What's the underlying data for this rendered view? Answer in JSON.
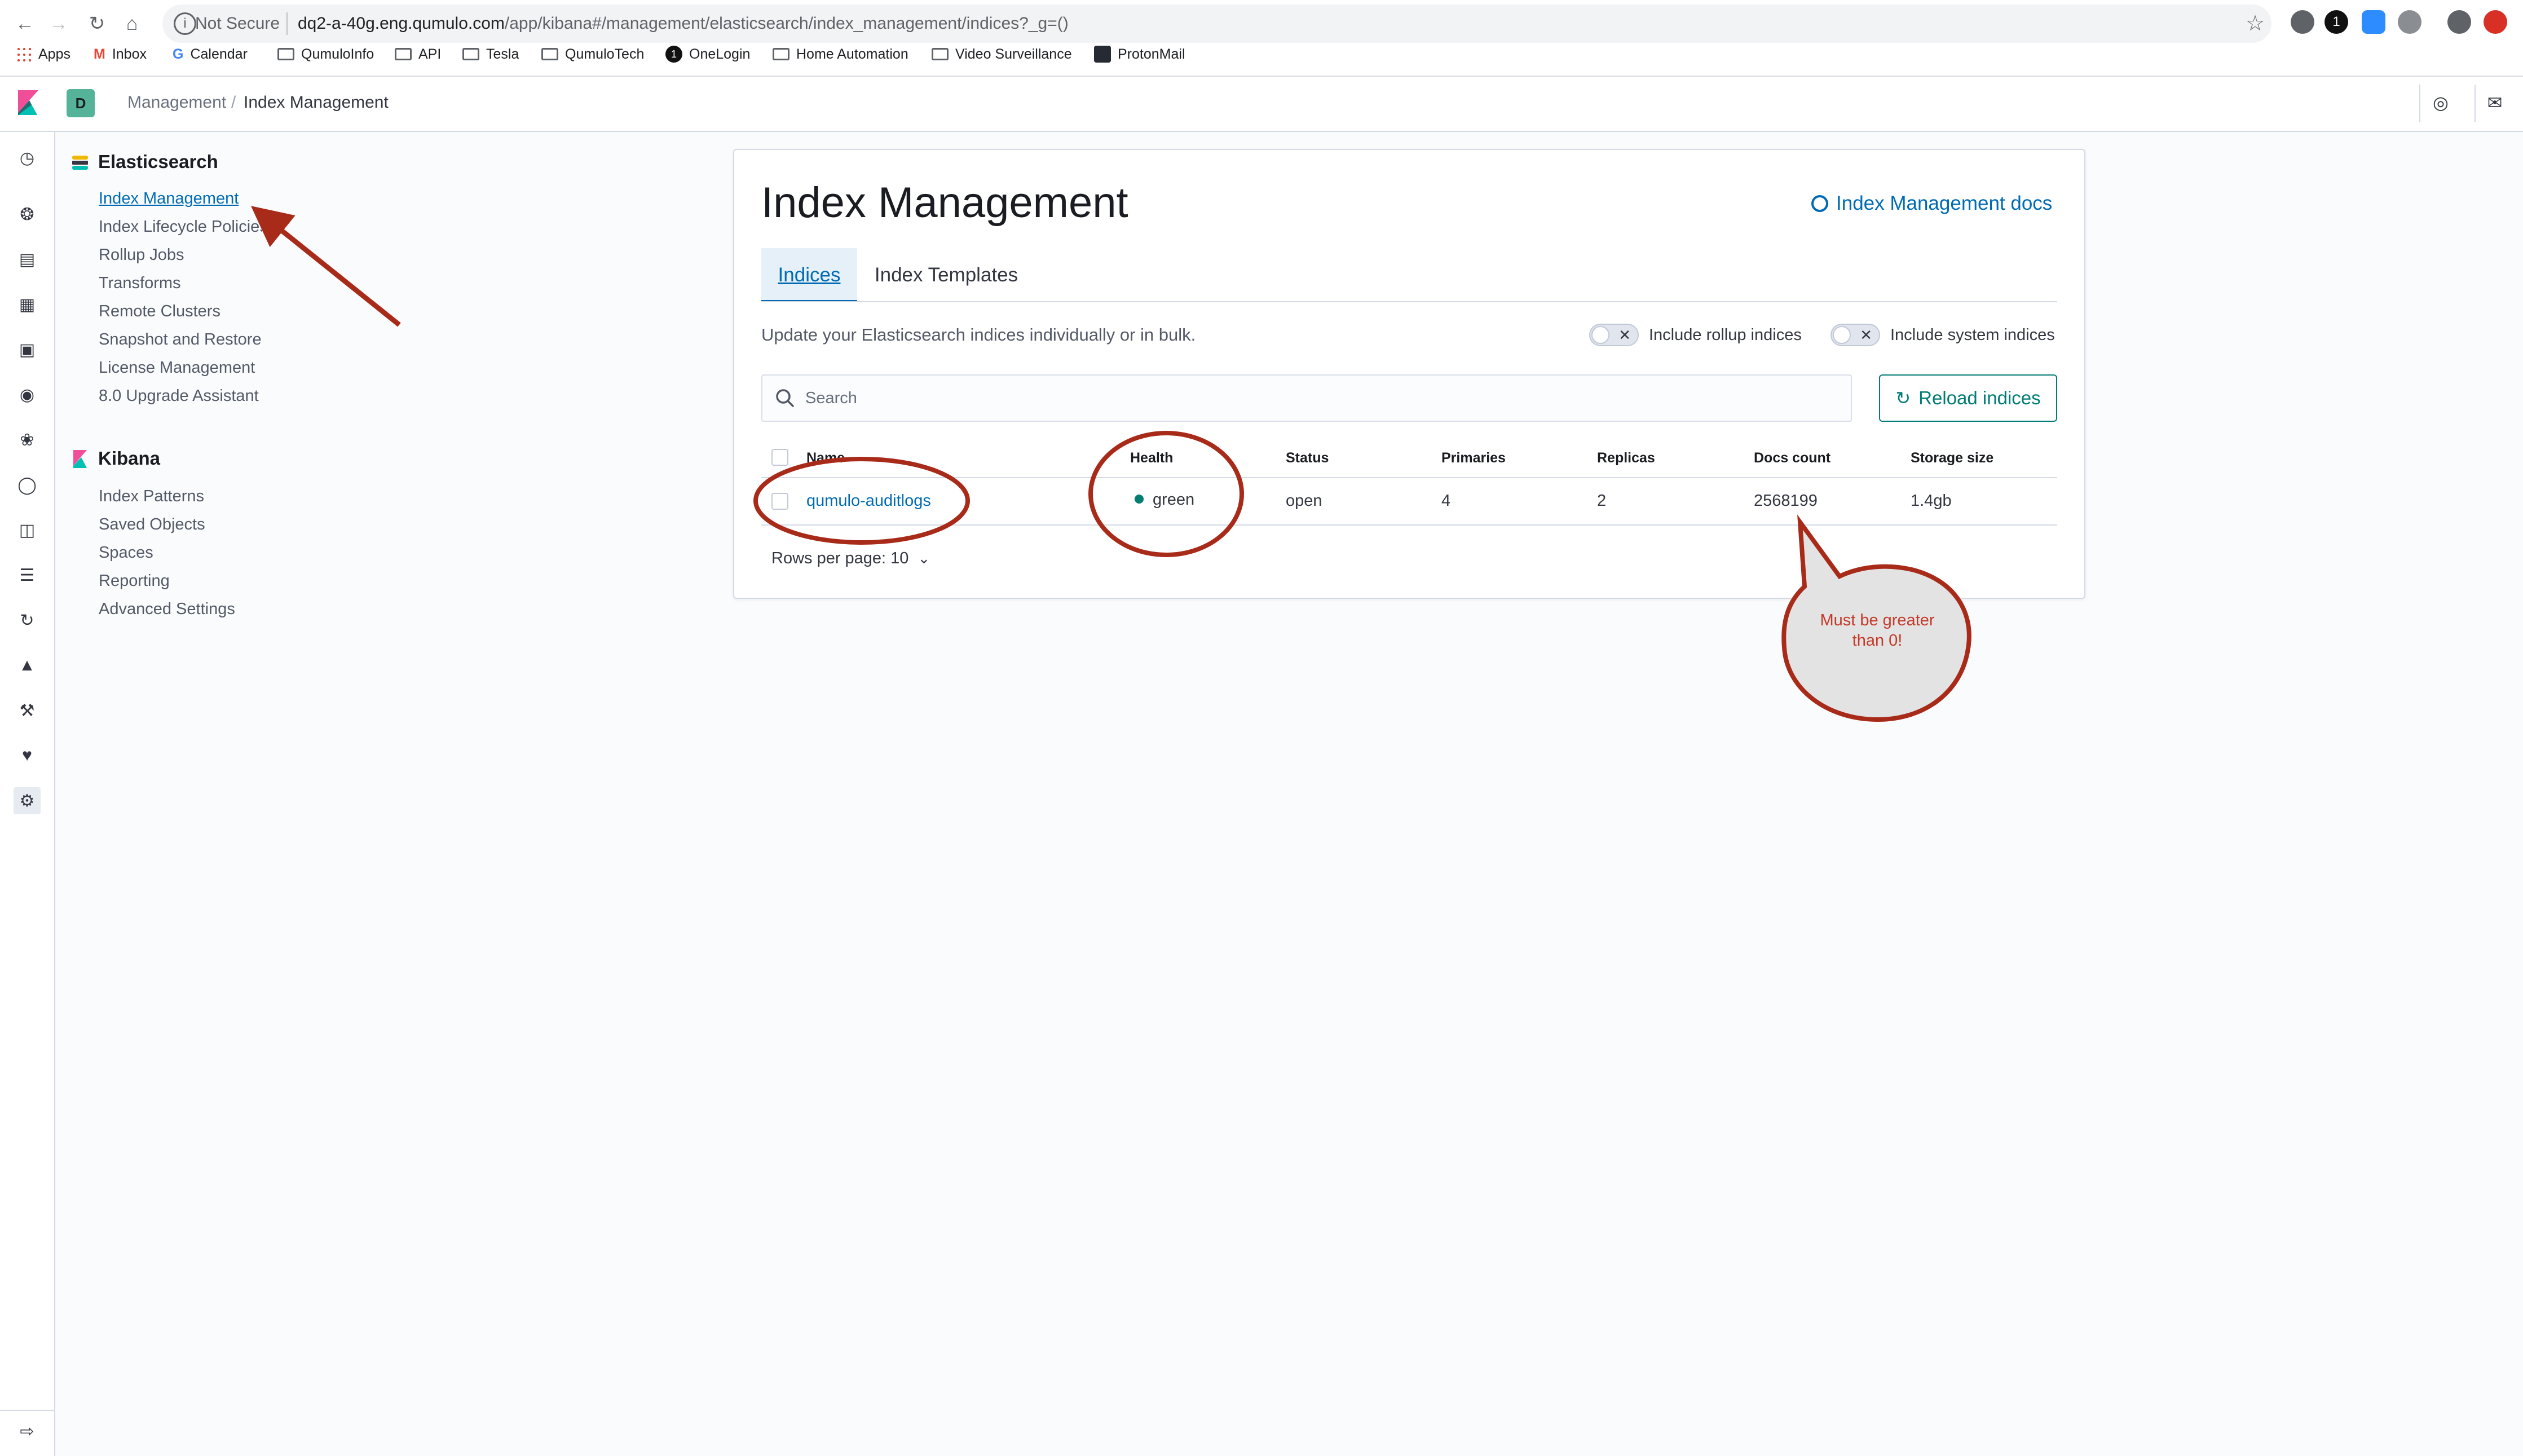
{
  "browser": {
    "url_security": "Not Secure",
    "url_domain": "dq2-a-40g.eng.qumulo.com",
    "url_path": "/app/kibana#/management/elasticsearch/index_management/indices?_g=()",
    "bookmarks": [
      "Apps",
      "Inbox",
      "Calendar",
      "QumuloInfo",
      "API",
      "Tesla",
      "QumuloTech",
      "OneLogin",
      "Home Automation",
      "Video Surveillance",
      "ProtonMail"
    ]
  },
  "header": {
    "space_initial": "D",
    "breadcrumb_parent": "Management",
    "breadcrumb_current": "Index Management"
  },
  "sidebar": {
    "elasticsearch_title": "Elasticsearch",
    "elasticsearch_items": [
      "Index Management",
      "Index Lifecycle Policies",
      "Rollup Jobs",
      "Transforms",
      "Remote Clusters",
      "Snapshot and Restore",
      "License Management",
      "8.0 Upgrade Assistant"
    ],
    "kibana_title": "Kibana",
    "kibana_items": [
      "Index Patterns",
      "Saved Objects",
      "Spaces",
      "Reporting",
      "Advanced Settings"
    ]
  },
  "main": {
    "title": "Index Management",
    "docs_link": "Index Management docs",
    "tabs": [
      "Indices",
      "Index Templates"
    ],
    "description": "Update your Elasticsearch indices individually or in bulk.",
    "toggle_rollup": "Include rollup indices",
    "toggle_system": "Include system indices",
    "search_placeholder": "Search",
    "reload_button": "Reload indices",
    "table": {
      "columns": [
        "Name",
        "Health",
        "Status",
        "Primaries",
        "Replicas",
        "Docs count",
        "Storage size"
      ],
      "rows": [
        {
          "name": "qumulo-auditlogs",
          "health": "green",
          "status": "open",
          "primaries": "4",
          "replicas": "2",
          "docs_count": "2568199",
          "storage_size": "1.4gb"
        }
      ]
    },
    "rows_per_page": "Rows per page: 10"
  },
  "annotation": {
    "callout_line1": "Must be greater",
    "callout_line2": "than 0!"
  },
  "colors": {
    "health_green": "#017d73",
    "annotation_red": "#a82b1a",
    "link_blue": "#006bb4"
  }
}
